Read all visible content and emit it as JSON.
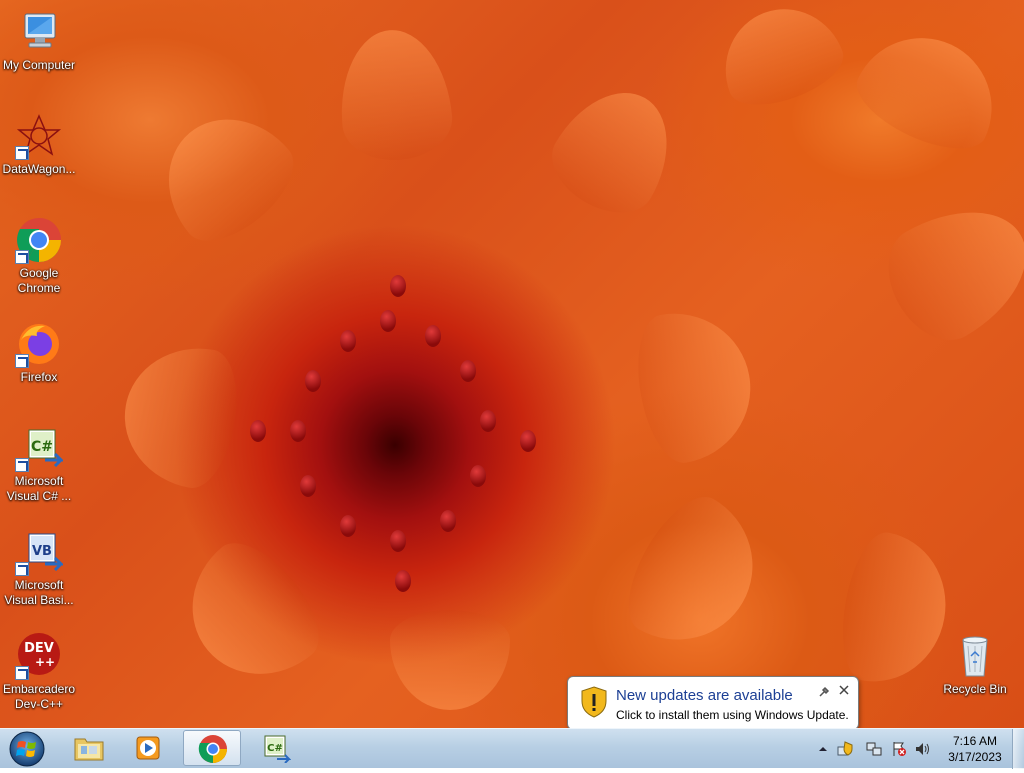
{
  "desktop": {
    "icons": [
      {
        "label": "My Computer",
        "icon": "computer-icon"
      },
      {
        "label": "DataWagon...",
        "icon": "datawagon-icon"
      },
      {
        "label": "Google Chrome",
        "icon": "chrome-icon"
      },
      {
        "label": "Firefox",
        "icon": "firefox-icon"
      },
      {
        "label": "Microsoft Visual C# ...",
        "icon": "visual-csharp-icon"
      },
      {
        "label": "Microsoft Visual Basi...",
        "icon": "visual-basic-icon"
      },
      {
        "label": "Embarcadero Dev-C++",
        "icon": "devcpp-icon"
      },
      {
        "label": "Recycle Bin",
        "icon": "recycle-bin-icon"
      }
    ]
  },
  "icon_texts": {
    "csharp": "C#",
    "vb": "VB",
    "dev": "DEV",
    "devpp": "++"
  },
  "notification": {
    "title": "New updates are available",
    "body": "Click to install them using Windows Update."
  },
  "taskbar": {
    "pinned": [
      {
        "name": "windows-explorer",
        "icon": "folder-icon",
        "active": false
      },
      {
        "name": "media-player",
        "icon": "media-player-icon",
        "active": false
      },
      {
        "name": "chrome",
        "icon": "chrome-icon",
        "active": true
      },
      {
        "name": "visual-csharp",
        "icon": "visual-csharp-icon",
        "active": false
      }
    ],
    "clock": {
      "time": "7:16 AM",
      "date": "3/17/2023"
    }
  },
  "colors": {
    "taskbar": "#b8cfe4",
    "notification_title": "#1c3f94",
    "wallpaper_primary": "#d9501a"
  }
}
